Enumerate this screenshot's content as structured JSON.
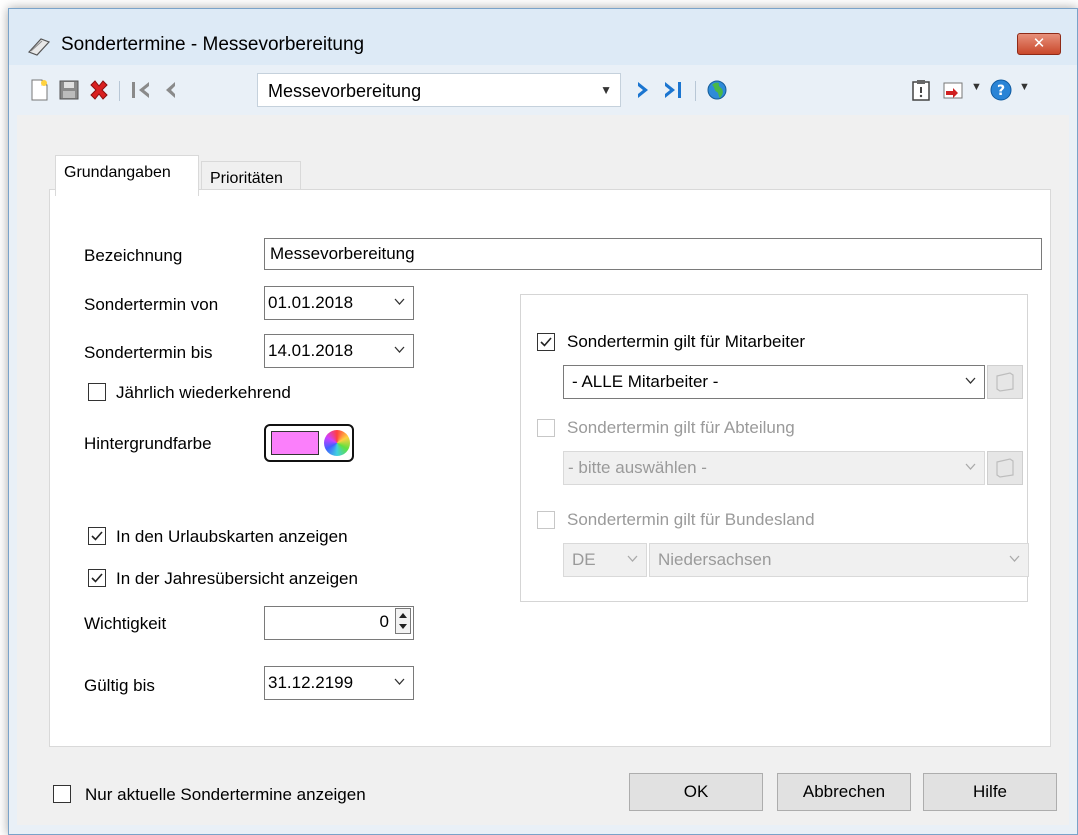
{
  "window": {
    "title": "Sondertermine - Messevorbereitung",
    "close_label": "✕"
  },
  "toolbar": {
    "record_selector": "Messevorbereitung",
    "icons": [
      "new-icon",
      "save-icon",
      "delete-icon",
      "first-record-icon",
      "previous-record-icon",
      "next-record-icon",
      "last-record-icon",
      "globe-icon",
      "clipboard-icon",
      "export-icon",
      "help-icon"
    ]
  },
  "tabs": [
    {
      "label": "Grundangaben",
      "active": true
    },
    {
      "label": "Prioritäten",
      "active": false
    }
  ],
  "form": {
    "bezeichnung_label": "Bezeichnung",
    "bezeichnung_value": "Messevorbereitung",
    "von_label": "Sondertermin von",
    "von_value": "01.01.2018",
    "bis_label": "Sondertermin bis",
    "bis_value": "14.01.2018",
    "jaehrlich_label": "Jährlich wiederkehrend",
    "jaehrlich_checked": false,
    "farbe_label": "Hintergrundfarbe",
    "farbe_value": "#fb7ffb",
    "urlaubskarten_label": "In den Urlaubskarten anzeigen",
    "urlaubskarten_checked": true,
    "jahresuebersicht_label": "In der Jahresübersicht anzeigen",
    "jahresuebersicht_checked": true,
    "wichtigkeit_label": "Wichtigkeit",
    "wichtigkeit_value": "0",
    "gueltig_label": "Gültig bis",
    "gueltig_value": "31.12.2199"
  },
  "scope": {
    "mitarbeiter_label": "Sondertermin gilt für Mitarbeiter",
    "mitarbeiter_checked": true,
    "mitarbeiter_value": "- ALLE Mitarbeiter -",
    "abteilung_label": "Sondertermin gilt für Abteilung",
    "abteilung_checked": false,
    "abteilung_value": "- bitte auswählen -",
    "bundesland_label": "Sondertermin gilt für Bundesland",
    "bundesland_checked": false,
    "land_value": "DE",
    "bundesland_value": "Niedersachsen"
  },
  "footer": {
    "nur_aktuelle_label": "Nur aktuelle Sondertermine anzeigen",
    "nur_aktuelle_checked": false,
    "ok_label": "OK",
    "cancel_label": "Abbrechen",
    "help_label": "Hilfe"
  }
}
